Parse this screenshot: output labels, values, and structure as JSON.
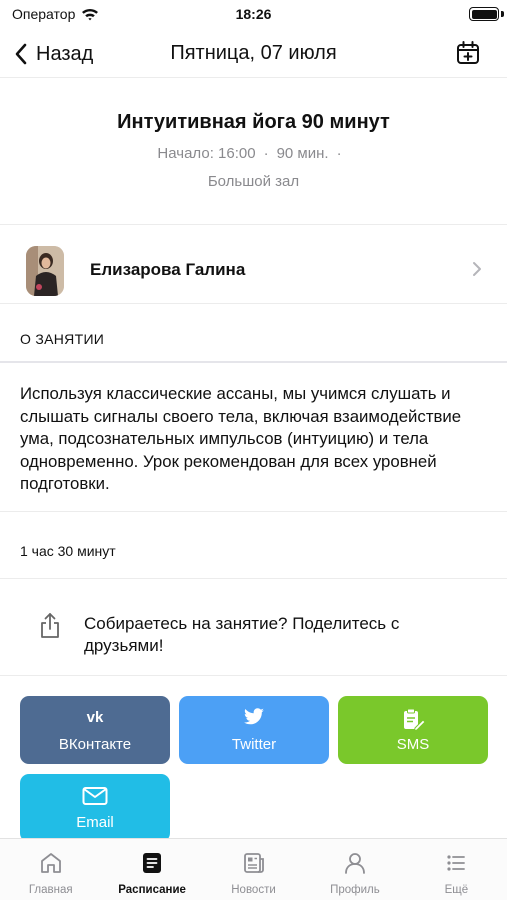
{
  "status_bar": {
    "carrier": "Оператор",
    "time": "18:26"
  },
  "nav": {
    "back_label": "Назад",
    "title": "Пятница, 07 июля"
  },
  "class_info": {
    "title": "Интуитивная йога 90 минут",
    "start": "Начало: 16:00",
    "length": "90 мин.",
    "separator": "·",
    "room": "Большой зал"
  },
  "trainer": {
    "name": "Елизарова Галина"
  },
  "about": {
    "header": "О ЗАНЯТИИ",
    "description": "Используя классические ассаны, мы учимся слушать и слышать сигналы своего тела, включая взаимодействие ума, подсознательных импульсов (интуицию) и тела одновременно. Урок рекомендован для всех уровней подготовки."
  },
  "duration": "1 час 30 минут",
  "share": {
    "prompt": "Собираетесь на занятие? Поделитесь с друзьями!",
    "buttons": [
      {
        "label": "ВКонтакте",
        "icon": "vk-icon",
        "color": "#4e6b92"
      },
      {
        "label": "Twitter",
        "icon": "twitter-icon",
        "color": "#4ca0f5"
      },
      {
        "label": "SMS",
        "icon": "sms-icon",
        "color": "#7ac82b"
      },
      {
        "label": "Email",
        "icon": "email-icon",
        "color": "#21bde6"
      }
    ]
  },
  "tabs": [
    {
      "label": "Главная",
      "icon": "home-icon",
      "active": false
    },
    {
      "label": "Расписание",
      "icon": "schedule-icon",
      "active": true
    },
    {
      "label": "Новости",
      "icon": "news-icon",
      "active": false
    },
    {
      "label": "Профиль",
      "icon": "profile-icon",
      "active": false
    },
    {
      "label": "Ещё",
      "icon": "more-icon",
      "active": false
    }
  ]
}
